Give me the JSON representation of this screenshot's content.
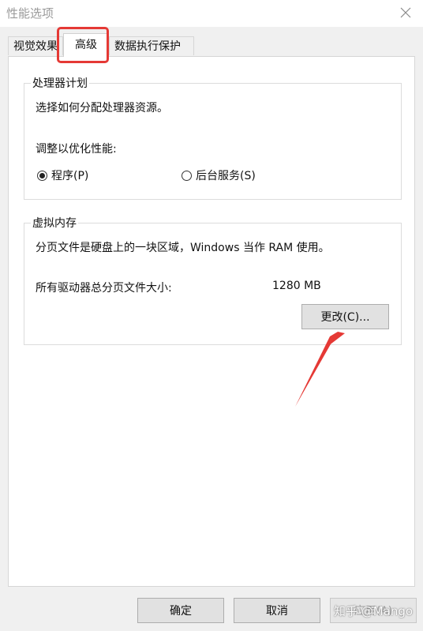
{
  "window": {
    "title": "性能选项"
  },
  "tabs": [
    {
      "label": "视觉效果"
    },
    {
      "label": "高级"
    },
    {
      "label": "数据执行保护"
    }
  ],
  "processor": {
    "title": "处理器计划",
    "description": "选择如何分配处理器资源。",
    "adjust_label": "调整以优化性能:",
    "options": [
      {
        "label": "程序(P)",
        "checked": true
      },
      {
        "label": "后台服务(S)",
        "checked": false
      }
    ]
  },
  "virtual_memory": {
    "title": "虚拟内存",
    "description": "分页文件是硬盘上的一块区域，Windows 当作 RAM 使用。",
    "total_label": "所有驱动器总分页文件大小:",
    "total_value": "1280 MB",
    "change_button": "更改(C)..."
  },
  "footer": {
    "ok": "确定",
    "cancel": "取消",
    "apply": "应用(A)"
  },
  "watermark": "知乎 @Mango",
  "annotation_color": "#e53935"
}
